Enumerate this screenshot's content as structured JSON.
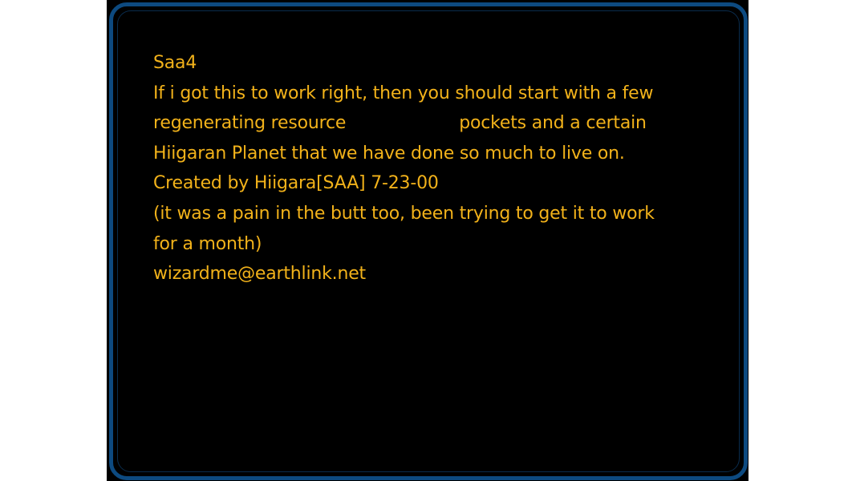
{
  "briefing": {
    "title": "Saa4",
    "line1": "If i got this to work right, then you should start with a few",
    "line2a": "regenerating resource",
    "line2b": "pockets and a certain",
    "line3": "Hiigaran Planet that we have done so much to live on.",
    "line4": "Created by Hiigara[SAA] 7-23-00",
    "line5": "(it was a pain in the butt too, been trying to get it to work",
    "line6": "for a month)",
    "line7": "wizardme@earthlink.net"
  },
  "colors": {
    "text": "#f2b21a",
    "frame": "#0d4a80",
    "background": "#000000"
  }
}
